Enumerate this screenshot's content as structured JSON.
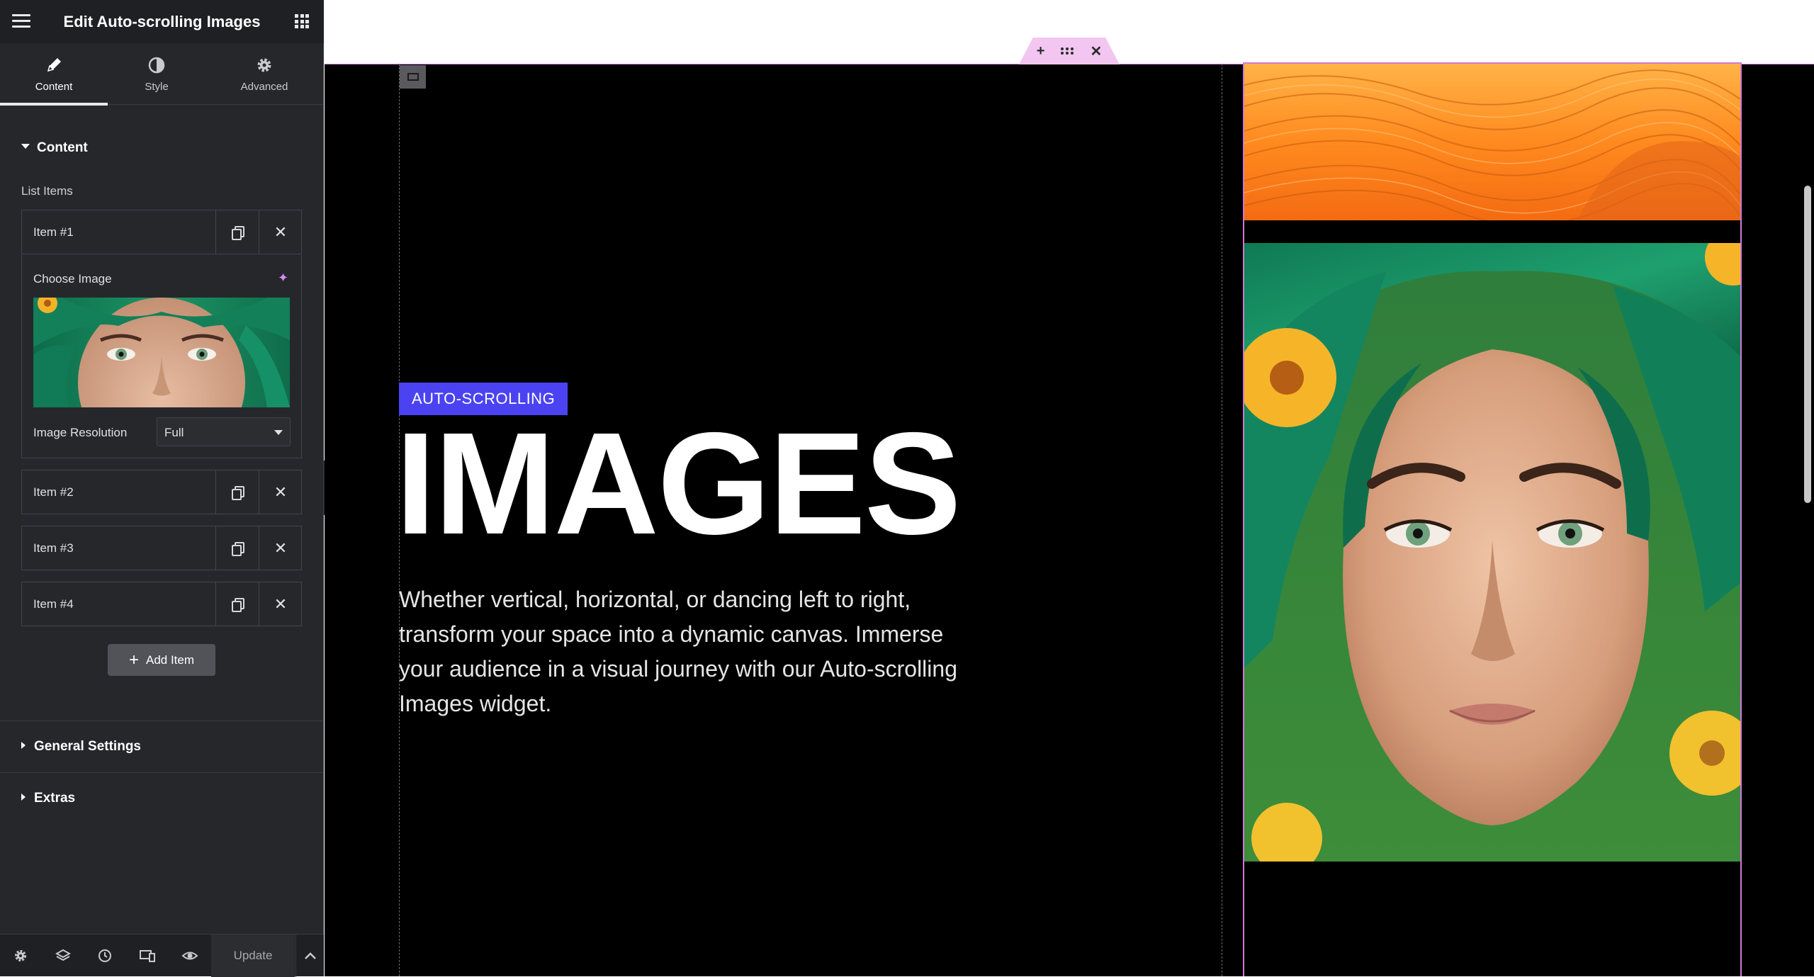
{
  "editor": {
    "title": "Edit Auto-scrolling Images",
    "tabs": [
      {
        "label": "Content",
        "icon": "pencil-icon"
      },
      {
        "label": "Style",
        "icon": "contrast-icon"
      },
      {
        "label": "Advanced",
        "icon": "gear-icon"
      }
    ],
    "content_section": "Content",
    "list_label": "List Items",
    "items": [
      {
        "label": "Item #1"
      },
      {
        "label": "Item #2"
      },
      {
        "label": "Item #3"
      },
      {
        "label": "Item #4"
      }
    ],
    "choose_image_label": "Choose Image",
    "image_resolution_label": "Image Resolution",
    "image_resolution_value": "Full",
    "add_item_label": "Add Item",
    "general_settings": "General Settings",
    "extras": "Extras",
    "update_label": "Update"
  },
  "canvas": {
    "badge": "AUTO-SCROLLING",
    "headline": "IMAGES",
    "description": "Whether vertical, horizontal, or dancing left to right, transform your space into a dynamic canvas. Immerse your audience in a visual journey with our Auto-scrolling Images widget."
  },
  "colors": {
    "sidebar_bg": "#26272b",
    "badge_bg": "#4b43f2",
    "selection_outline": "#cf7ad6",
    "ai_accent": "#d58cf6"
  }
}
